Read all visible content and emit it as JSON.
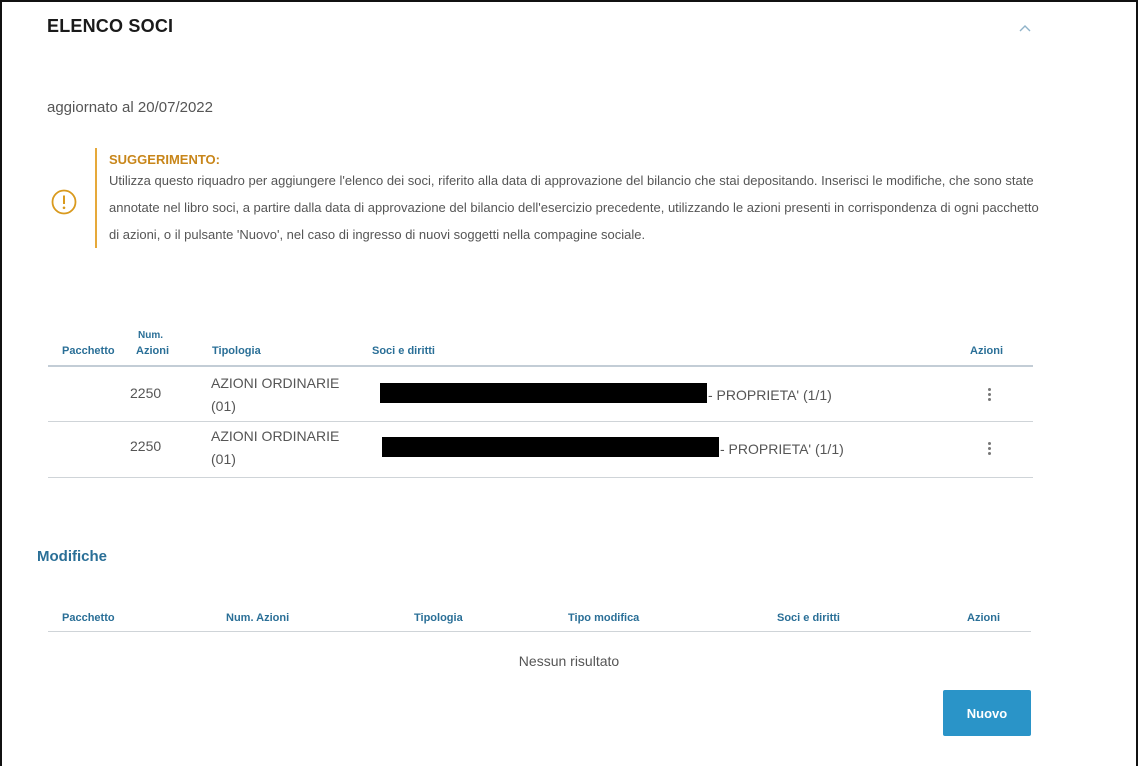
{
  "header": {
    "title": "ELENCO SOCI",
    "collapse_icon": "chevron-up-icon"
  },
  "updated": "aggiornato al 20/07/2022",
  "hint": {
    "icon": "exclamation-circle-icon",
    "title": "SUGGERIMENTO:",
    "text": "Utilizza questo riquadro per aggiungere l'elenco dei soci, riferito alla data di approvazione del bilancio che stai depositando. Inserisci le modifiche, che sono state annotate nel libro soci, a partire dalla data di approvazione del bilancio dell'esercizio precedente, utilizzando le azioni presenti in corrispondenza di ogni pacchetto di azioni, o il pulsante 'Nuovo', nel caso di ingresso di nuovi soggetti nella compagine sociale.",
    "accent_color": "#e6a93a"
  },
  "soci_table": {
    "headers": {
      "pacchetto": "Pacchetto",
      "num_1": "Num.",
      "num_2": "Azioni",
      "tipologia": "Tipologia",
      "soci": "Soci e diritti",
      "azioni": "Azioni"
    },
    "rows": [
      {
        "num_azioni": "2250",
        "tipologia_1": "AZIONI ORDINARIE",
        "tipologia_2": "(01)",
        "diritti": "- PROPRIETA' (1/1)"
      },
      {
        "num_azioni": "2250",
        "tipologia_1": "AZIONI ORDINARIE",
        "tipologia_2": "(01)",
        "diritti": "- PROPRIETA' (1/1)"
      }
    ]
  },
  "modifiche": {
    "title": "Modifiche",
    "headers": {
      "pacchetto": "Pacchetto",
      "num_azioni": "Num. Azioni",
      "tipologia": "Tipologia",
      "tipo_modifica": "Tipo modifica",
      "soci": "Soci e diritti",
      "azioni": "Azioni"
    },
    "empty": "Nessun risultato",
    "new_button": "Nuovo"
  },
  "colors": {
    "link_blue": "#2a6f97",
    "button_blue": "#2a94c8"
  }
}
